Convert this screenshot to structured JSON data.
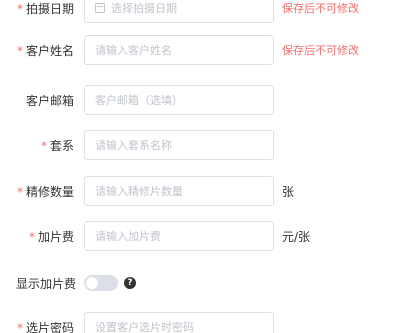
{
  "form": {
    "shoot_date": {
      "label": "拍摄日期",
      "required": "*",
      "placeholder": "选择拍摄日期",
      "warning": "保存后不可修改"
    },
    "customer_name": {
      "label": "客户姓名",
      "required": "*",
      "placeholder": "请输入客户姓名",
      "warning": "保存后不可修改"
    },
    "customer_email": {
      "label": "客户邮箱",
      "placeholder": "客户邮箱（选填）"
    },
    "package": {
      "label": "套系",
      "required": "*",
      "placeholder": "请输入套系名称"
    },
    "retouch_count": {
      "label": "精修数量",
      "required": "*",
      "placeholder": "请输入精修片数量",
      "suffix": "张"
    },
    "extra_fee": {
      "label": "加片费",
      "required": "*",
      "placeholder": "请输入加片费",
      "suffix": "元/张"
    },
    "show_extra_fee": {
      "label": "显示加片费",
      "enabled": false,
      "help": "?"
    },
    "photo_password": {
      "label": "选片密码",
      "required": "*",
      "placeholder": "设置客户选片时密码"
    }
  },
  "colors": {
    "required": "#f56c6c",
    "warning": "#f56c6c",
    "border": "#dcdfe6",
    "placeholder": "#c0c4cc"
  }
}
